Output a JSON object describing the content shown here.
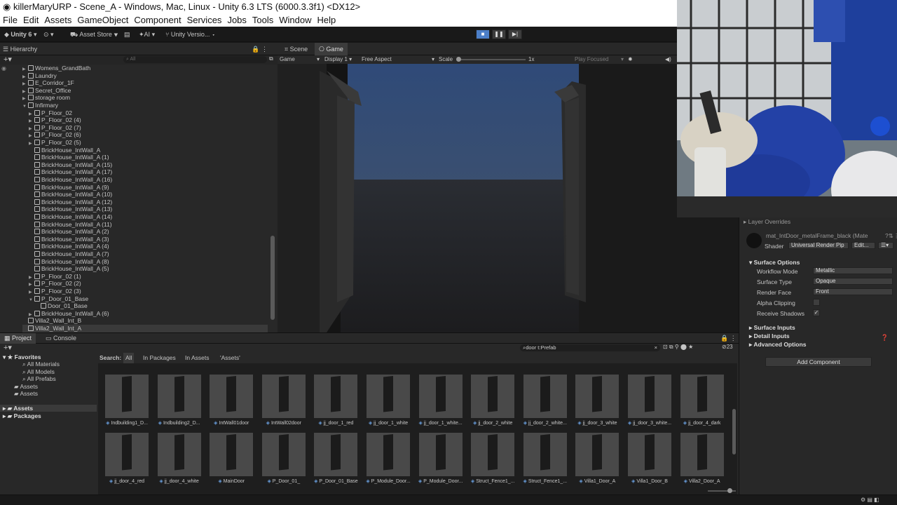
{
  "window": {
    "title": "killerMaryURP - Scene_A - Windows, Mac, Linux - Unity 6.3 LTS (6000.3.3f1) <DX12>"
  },
  "menu": [
    "File",
    "Edit",
    "Assets",
    "GameObject",
    "Component",
    "Services",
    "Jobs",
    "Tools",
    "Window",
    "Help"
  ],
  "toolbar": {
    "account": "Unity 6",
    "asset_store": "Asset Store",
    "ai": "AI",
    "version_control": "Unity Versio..."
  },
  "hierarchy": {
    "title": "Hierarchy",
    "search_placeholder": "All",
    "items": [
      {
        "label": "Womens_GrandBath",
        "depth": 0,
        "expand": "collapsed"
      },
      {
        "label": "Laundry",
        "depth": 0,
        "expand": "collapsed"
      },
      {
        "label": "E_Corridor_1F",
        "depth": 0,
        "expand": "collapsed"
      },
      {
        "label": "Secret_Office",
        "depth": 0,
        "expand": "collapsed"
      },
      {
        "label": "storage room",
        "depth": 0,
        "expand": "collapsed"
      },
      {
        "label": "Infirmary",
        "depth": 0,
        "expand": "expanded"
      },
      {
        "label": "P_Floor_02",
        "depth": 1,
        "expand": "collapsed"
      },
      {
        "label": "P_Floor_02 (4)",
        "depth": 1,
        "expand": "collapsed"
      },
      {
        "label": "P_Floor_02 (7)",
        "depth": 1,
        "expand": "collapsed"
      },
      {
        "label": "P_Floor_02 (6)",
        "depth": 1,
        "expand": "collapsed"
      },
      {
        "label": "P_Floor_02 (5)",
        "depth": 1,
        "expand": "collapsed"
      },
      {
        "label": "BrickHouse_IntWall_A",
        "depth": 1,
        "expand": "none"
      },
      {
        "label": "BrickHouse_IntWall_A (1)",
        "depth": 1,
        "expand": "none"
      },
      {
        "label": "BrickHouse_IntWall_A (15)",
        "depth": 1,
        "expand": "none"
      },
      {
        "label": "BrickHouse_IntWall_A (17)",
        "depth": 1,
        "expand": "none"
      },
      {
        "label": "BrickHouse_IntWall_A (16)",
        "depth": 1,
        "expand": "none"
      },
      {
        "label": "BrickHouse_IntWall_A (9)",
        "depth": 1,
        "expand": "none"
      },
      {
        "label": "BrickHouse_IntWall_A (10)",
        "depth": 1,
        "expand": "none"
      },
      {
        "label": "BrickHouse_IntWall_A (12)",
        "depth": 1,
        "expand": "none"
      },
      {
        "label": "BrickHouse_IntWall_A (13)",
        "depth": 1,
        "expand": "none"
      },
      {
        "label": "BrickHouse_IntWall_A (14)",
        "depth": 1,
        "expand": "none"
      },
      {
        "label": "BrickHouse_IntWall_A (11)",
        "depth": 1,
        "expand": "none"
      },
      {
        "label": "BrickHouse_IntWall_A (2)",
        "depth": 1,
        "expand": "none"
      },
      {
        "label": "BrickHouse_IntWall_A (3)",
        "depth": 1,
        "expand": "none"
      },
      {
        "label": "BrickHouse_IntWall_A (4)",
        "depth": 1,
        "expand": "none"
      },
      {
        "label": "BrickHouse_IntWall_A (7)",
        "depth": 1,
        "expand": "none"
      },
      {
        "label": "BrickHouse_IntWall_A (8)",
        "depth": 1,
        "expand": "none"
      },
      {
        "label": "BrickHouse_IntWall_A (5)",
        "depth": 1,
        "expand": "none"
      },
      {
        "label": "P_Floor_02 (1)",
        "depth": 1,
        "expand": "collapsed"
      },
      {
        "label": "P_Floor_02 (2)",
        "depth": 1,
        "expand": "collapsed"
      },
      {
        "label": "P_Floor_02 (3)",
        "depth": 1,
        "expand": "collapsed"
      },
      {
        "label": "P_Door_01_Base",
        "depth": 1,
        "expand": "expanded"
      },
      {
        "label": "Door_01_Base",
        "depth": 2,
        "expand": "none"
      },
      {
        "label": "BrickHouse_IntWall_A (6)",
        "depth": 1,
        "expand": "collapsed"
      },
      {
        "label": "Villa2_Wall_Int_B",
        "depth": 0,
        "expand": "none"
      },
      {
        "label": "Villa2_Wall_Int_A",
        "depth": 0,
        "expand": "none"
      }
    ]
  },
  "scene_tabs": [
    "Scene",
    "Game"
  ],
  "game_bar": {
    "mode": "Game",
    "display": "Display 1",
    "aspect": "Free Aspect",
    "scale_label": "Scale",
    "scale_value": "1x",
    "play_focused": "Play Focused"
  },
  "inspector": {
    "layer_overrides": "Layer Overrides",
    "material_name": "mat_IntDoor_metalFrame_black (Mate",
    "shader_label": "Shader",
    "shader_value": "Universal Render Pip",
    "edit_label": "Edit...",
    "surface_options": "Surface Options",
    "props": [
      {
        "label": "Workflow Mode",
        "value": "Metallic"
      },
      {
        "label": "Surface Type",
        "value": "Opaque"
      },
      {
        "label": "Render Face",
        "value": "Front"
      },
      {
        "label": "Alpha Clipping",
        "value": ""
      },
      {
        "label": "Receive Shadows",
        "value": "✓"
      }
    ],
    "sections": [
      "Surface Inputs",
      "Detail Inputs",
      "Advanced Options"
    ],
    "add_component": "Add Component"
  },
  "project": {
    "tabs": [
      "Project",
      "Console"
    ],
    "search_value": "door t:Prefab",
    "count": "23",
    "search_label": "Search:",
    "filters": [
      "All",
      "In Packages",
      "In Assets",
      "'Assets'"
    ],
    "favorites_title": "Favorites",
    "favorites": [
      "All Materials",
      "All Models",
      "All Prefabs",
      "Assets",
      "Assets"
    ],
    "roots": [
      "Assets",
      "Packages"
    ],
    "row1": [
      "Indbuilding1_D...",
      "Indbuilding2_D...",
      "IntWall01door",
      "IntWall02door",
      "jj_door_1_red",
      "jj_door_1_white",
      "jj_door_1_white...",
      "jj_door_2_white",
      "jj_door_2_white...",
      "jj_door_3_white",
      "jj_door_3_white...",
      "jj_door_4_dark"
    ],
    "row2": [
      "jj_door_4_red",
      "jj_door_4_white",
      "MainDoor",
      "P_Door_01_",
      "P_Door_01_Base",
      "P_Module_Door...",
      "P_Module_Door...",
      "Struct_Fence1_...",
      "Struct_Fence1_...",
      "Villa1_Door_A",
      "Villa1_Door_B",
      "Villa2_Door_A"
    ]
  }
}
